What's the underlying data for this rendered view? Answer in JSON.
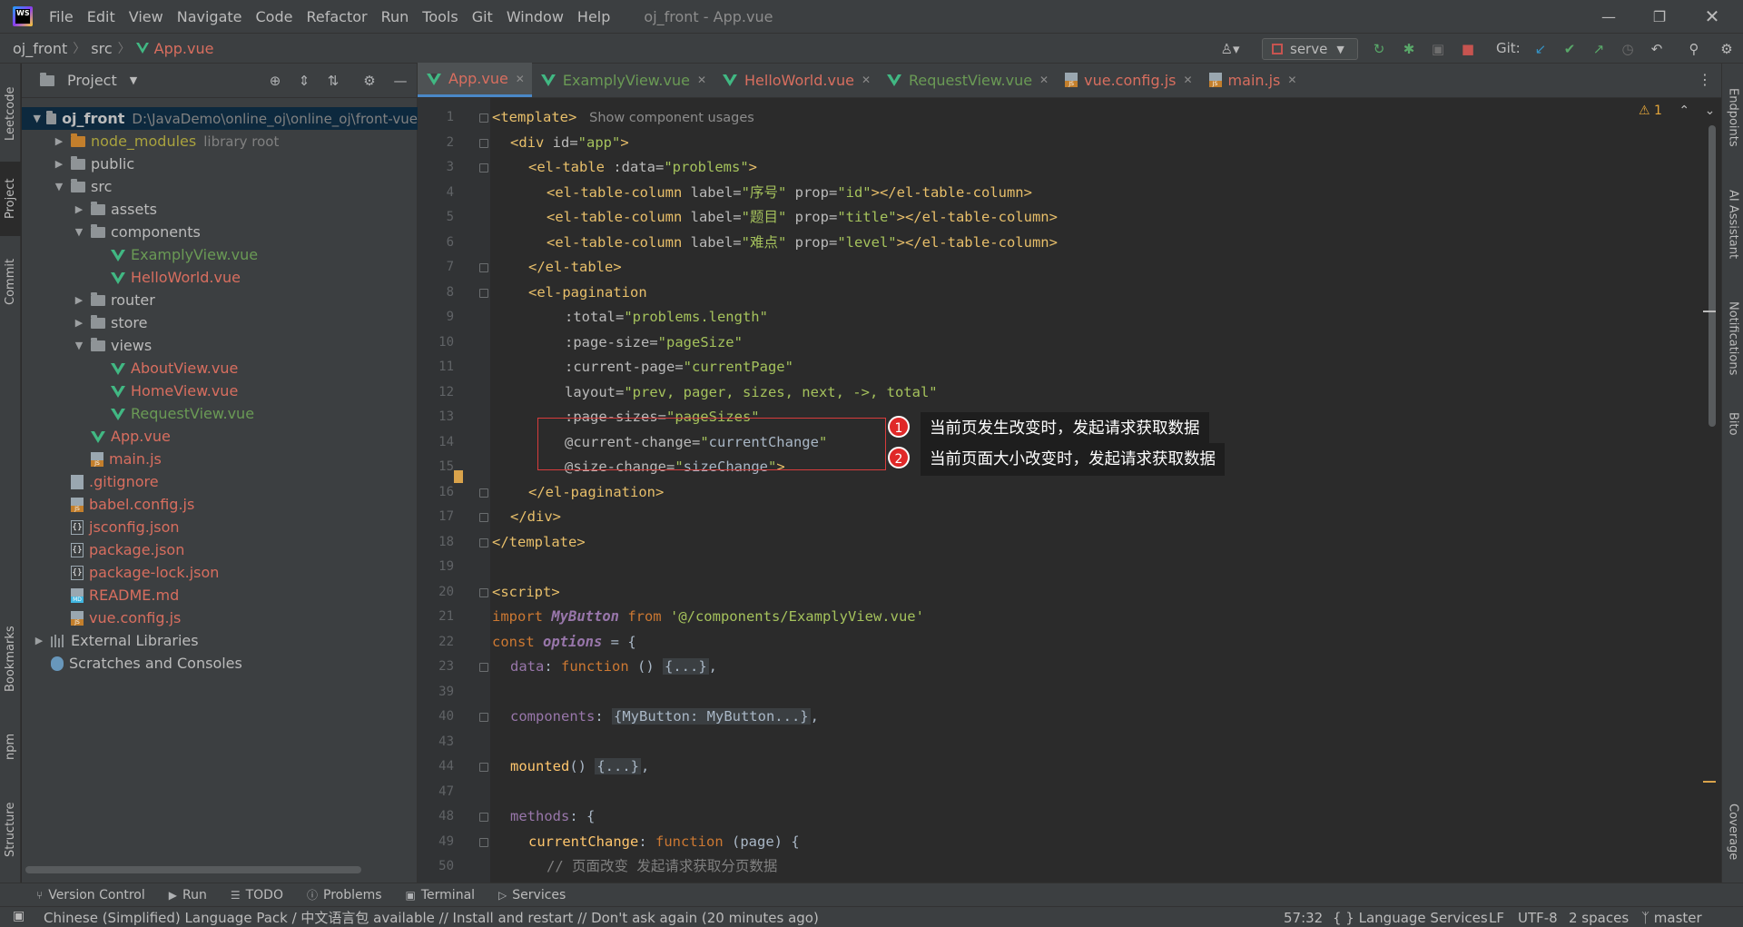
{
  "titlebar": {
    "logo_text": "WS",
    "menus": [
      "File",
      "Edit",
      "View",
      "Navigate",
      "Code",
      "Refactor",
      "Run",
      "Tools",
      "Git",
      "Window",
      "Help"
    ],
    "window_title": "oj_front - App.vue"
  },
  "navbar": {
    "breadcrumb": [
      "oj_front",
      "src",
      "App.vue"
    ],
    "run_config": "serve",
    "git_label": "Git:"
  },
  "left_strip": [
    "Leetcode",
    "Project",
    "Commit",
    "Bookmarks",
    "npm",
    "Structure"
  ],
  "right_strip": [
    "Endpoints",
    "AI Assistant",
    "Notifications",
    "Bito",
    "Coverage"
  ],
  "project": {
    "title": "Project",
    "tree": [
      {
        "name": "oj_front",
        "extra": "D:\\JavaDemo\\online_oj\\online_oj\\front-vue",
        "type": "folder",
        "indent": 0,
        "expanded": true,
        "color": "plain",
        "bold": true,
        "selected": true
      },
      {
        "name": "node_modules",
        "extra": "library root",
        "type": "folder-orange",
        "indent": 1,
        "expanded": false,
        "color": "yellow"
      },
      {
        "name": "public",
        "type": "folder",
        "indent": 1,
        "expanded": false,
        "color": "plain"
      },
      {
        "name": "src",
        "type": "folder",
        "indent": 1,
        "expanded": true,
        "color": "plain"
      },
      {
        "name": "assets",
        "type": "folder",
        "indent": 2,
        "expanded": false,
        "color": "plain"
      },
      {
        "name": "components",
        "type": "folder",
        "indent": 2,
        "expanded": true,
        "color": "plain"
      },
      {
        "name": "ExamplyView.vue",
        "type": "vue",
        "indent": 3,
        "color": "green"
      },
      {
        "name": "HelloWorld.vue",
        "type": "vue",
        "indent": 3,
        "color": "red"
      },
      {
        "name": "router",
        "type": "folder",
        "indent": 2,
        "expanded": false,
        "color": "plain"
      },
      {
        "name": "store",
        "type": "folder",
        "indent": 2,
        "expanded": false,
        "color": "plain"
      },
      {
        "name": "views",
        "type": "folder",
        "indent": 2,
        "expanded": true,
        "color": "plain"
      },
      {
        "name": "AboutView.vue",
        "type": "vue",
        "indent": 3,
        "color": "red"
      },
      {
        "name": "HomeView.vue",
        "type": "vue",
        "indent": 3,
        "color": "red"
      },
      {
        "name": "RequestView.vue",
        "type": "vue",
        "indent": 3,
        "color": "green"
      },
      {
        "name": "App.vue",
        "type": "vue",
        "indent": 2,
        "color": "red"
      },
      {
        "name": "main.js",
        "type": "js",
        "indent": 2,
        "color": "red"
      },
      {
        "name": ".gitignore",
        "type": "file",
        "indent": 1,
        "color": "red"
      },
      {
        "name": "babel.config.js",
        "type": "js",
        "indent": 1,
        "color": "red"
      },
      {
        "name": "jsconfig.json",
        "type": "json",
        "indent": 1,
        "color": "red"
      },
      {
        "name": "package.json",
        "type": "json",
        "indent": 1,
        "color": "red"
      },
      {
        "name": "package-lock.json",
        "type": "json",
        "indent": 1,
        "color": "red"
      },
      {
        "name": "README.md",
        "type": "md",
        "indent": 1,
        "color": "red"
      },
      {
        "name": "vue.config.js",
        "type": "js",
        "indent": 1,
        "color": "red"
      },
      {
        "name": "External Libraries",
        "type": "lib",
        "indent": 0,
        "expanded": false,
        "color": "plain"
      },
      {
        "name": "Scratches and Consoles",
        "type": "scratch",
        "indent": 0,
        "color": "plain"
      }
    ]
  },
  "tabs": [
    {
      "label": "App.vue",
      "icon": "vue",
      "color": "red",
      "active": true
    },
    {
      "label": "ExamplyView.vue",
      "icon": "vue",
      "color": "green"
    },
    {
      "label": "HelloWorld.vue",
      "icon": "vue",
      "color": "red"
    },
    {
      "label": "RequestView.vue",
      "icon": "vue",
      "color": "green"
    },
    {
      "label": "vue.config.js",
      "icon": "js",
      "color": "red"
    },
    {
      "label": "main.js",
      "icon": "js",
      "color": "red"
    }
  ],
  "code_lines": [
    {
      "n": "1",
      "indent": 0,
      "fold": true,
      "parts": [
        [
          "tag",
          "<template>"
        ],
        [
          "hint",
          "   Show component usages"
        ]
      ]
    },
    {
      "n": "2",
      "indent": 1,
      "fold": true,
      "parts": [
        [
          "tag",
          "<div "
        ],
        [
          "attr",
          "id="
        ],
        [
          "str",
          "\"app\""
        ],
        [
          "tag",
          ">"
        ]
      ]
    },
    {
      "n": "3",
      "indent": 2,
      "fold": true,
      "parts": [
        [
          "tag",
          "<el-table "
        ],
        [
          "attr",
          ":data="
        ],
        [
          "str",
          "\"problems\""
        ],
        [
          "tag",
          ">"
        ]
      ]
    },
    {
      "n": "4",
      "indent": 3,
      "parts": [
        [
          "tag",
          "<el-table-column "
        ],
        [
          "attr",
          "label="
        ],
        [
          "str",
          "\"序号\" "
        ],
        [
          "attr",
          "prop="
        ],
        [
          "str",
          "\"id\""
        ],
        [
          "tag",
          "></el-table-column>"
        ]
      ]
    },
    {
      "n": "5",
      "indent": 3,
      "parts": [
        [
          "tag",
          "<el-table-column "
        ],
        [
          "attr",
          "label="
        ],
        [
          "str",
          "\"题目\" "
        ],
        [
          "attr",
          "prop="
        ],
        [
          "str",
          "\"title\""
        ],
        [
          "tag",
          "></el-table-column>"
        ]
      ]
    },
    {
      "n": "6",
      "indent": 3,
      "parts": [
        [
          "tag",
          "<el-table-column "
        ],
        [
          "attr",
          "label="
        ],
        [
          "str",
          "\"难点\" "
        ],
        [
          "attr",
          "prop="
        ],
        [
          "str",
          "\"level\""
        ],
        [
          "tag",
          "></el-table-column>"
        ]
      ]
    },
    {
      "n": "7",
      "indent": 2,
      "fold": true,
      "parts": [
        [
          "tag",
          "</el-table>"
        ]
      ]
    },
    {
      "n": "8",
      "indent": 2,
      "fold": true,
      "parts": [
        [
          "tag",
          "<el-pagination"
        ]
      ]
    },
    {
      "n": "9",
      "indent": 4,
      "parts": [
        [
          "attr",
          ":total="
        ],
        [
          "str",
          "\"problems.length\""
        ]
      ]
    },
    {
      "n": "10",
      "indent": 4,
      "parts": [
        [
          "attr",
          ":page-size="
        ],
        [
          "str",
          "\"pageSize\""
        ]
      ]
    },
    {
      "n": "11",
      "indent": 4,
      "parts": [
        [
          "attr",
          ":current-page="
        ],
        [
          "str",
          "\"currentPage\""
        ]
      ]
    },
    {
      "n": "12",
      "indent": 4,
      "parts": [
        [
          "attr",
          "layout="
        ],
        [
          "str",
          "\"prev, pager, sizes, next, ->, total\""
        ]
      ]
    },
    {
      "n": "13",
      "indent": 4,
      "parts": [
        [
          "attr",
          ":page-sizes="
        ],
        [
          "str",
          "\"pageSizes\""
        ]
      ]
    },
    {
      "n": "14",
      "indent": 4,
      "parts": [
        [
          "attr",
          "@current-change="
        ],
        [
          "str",
          "\""
        ],
        [
          "plain",
          "currentChange"
        ],
        [
          "str",
          "\""
        ]
      ]
    },
    {
      "n": "15",
      "indent": 4,
      "parts": [
        [
          "attr",
          "@size-change="
        ],
        [
          "str",
          "\""
        ],
        [
          "plain",
          "sizeChange"
        ],
        [
          "str",
          "\""
        ],
        [
          "tag",
          ">"
        ]
      ]
    },
    {
      "n": "16",
      "indent": 2,
      "fold": true,
      "parts": [
        [
          "tag",
          "</el-pagination>"
        ]
      ]
    },
    {
      "n": "17",
      "indent": 1,
      "fold": true,
      "parts": [
        [
          "tag",
          "</div>"
        ]
      ]
    },
    {
      "n": "18",
      "indent": 0,
      "fold": true,
      "parts": [
        [
          "tag",
          "</template>"
        ]
      ]
    },
    {
      "n": "19",
      "indent": 0,
      "parts": []
    },
    {
      "n": "20",
      "indent": 0,
      "fold": true,
      "parts": [
        [
          "tag",
          "<script>"
        ]
      ]
    },
    {
      "n": "21",
      "indent": 0,
      "parts": [
        [
          "kw",
          "import "
        ],
        [
          "bold",
          "MyButton"
        ],
        [
          "kw",
          " from "
        ],
        [
          "str",
          "'@/components/ExamplyView.vue'"
        ]
      ]
    },
    {
      "n": "22",
      "indent": 0,
      "parts": [
        [
          "kw",
          "const "
        ],
        [
          "bold",
          "options"
        ],
        [
          "plain",
          " = {"
        ]
      ]
    },
    {
      "n": "23",
      "indent": 1,
      "fold": true,
      "parts": [
        [
          "prop",
          "data"
        ],
        [
          "plain",
          ": "
        ],
        [
          "kw",
          "function "
        ],
        [
          "plain",
          "() "
        ],
        [
          "fold",
          "{...}"
        ],
        [
          "plain",
          ","
        ]
      ]
    },
    {
      "n": "39",
      "indent": 0,
      "parts": []
    },
    {
      "n": "40",
      "indent": 1,
      "fold": true,
      "parts": [
        [
          "prop",
          "components"
        ],
        [
          "plain",
          ": "
        ],
        [
          "fold",
          "{MyButton: MyButton...}"
        ],
        [
          "plain",
          ","
        ]
      ]
    },
    {
      "n": "43",
      "indent": 0,
      "parts": []
    },
    {
      "n": "44",
      "indent": 1,
      "fold": true,
      "parts": [
        [
          "def",
          "mounted"
        ],
        [
          "plain",
          "() "
        ],
        [
          "fold",
          "{...}"
        ],
        [
          "plain",
          ","
        ]
      ]
    },
    {
      "n": "47",
      "indent": 0,
      "parts": []
    },
    {
      "n": "48",
      "indent": 1,
      "fold": true,
      "parts": [
        [
          "prop",
          "methods"
        ],
        [
          "plain",
          ": {"
        ]
      ]
    },
    {
      "n": "49",
      "indent": 2,
      "fold": true,
      "parts": [
        [
          "def",
          "currentChange"
        ],
        [
          "plain",
          ": "
        ],
        [
          "kw",
          "function "
        ],
        [
          "plain",
          "(page) {"
        ]
      ]
    },
    {
      "n": "50",
      "indent": 3,
      "parts": [
        [
          "cmt",
          "// 页面改变 发起请求获取分页数据"
        ]
      ]
    }
  ],
  "callouts": [
    {
      "num": "1",
      "text": "当前页发生改变时，发起请求获取数据"
    },
    {
      "num": "2",
      "text": "当前页面大小改变时，发起请求获取数据"
    }
  ],
  "editor_status": {
    "warnings": "1"
  },
  "bottom_tools": [
    {
      "label": "Version Control",
      "icon": "branch-icon"
    },
    {
      "label": "Run",
      "icon": "play-icon"
    },
    {
      "label": "TODO",
      "icon": "list-icon"
    },
    {
      "label": "Problems",
      "icon": "info-icon"
    },
    {
      "label": "Terminal",
      "icon": "terminal-icon"
    },
    {
      "label": "Services",
      "icon": "services-icon"
    }
  ],
  "statusbar": {
    "message": "Chinese (Simplified) Language Pack / 中文语言包 available // Install and restart // Don't ask again (20 minutes ago)",
    "position": "57:32",
    "language_services": "{ } Language Services",
    "line_sep": "LF",
    "encoding": "UTF-8",
    "indent": "2 spaces",
    "branch": "master"
  },
  "colors": {
    "accent": "#4a88c7",
    "vue": "#41b883",
    "callout_red": "#e02828"
  }
}
